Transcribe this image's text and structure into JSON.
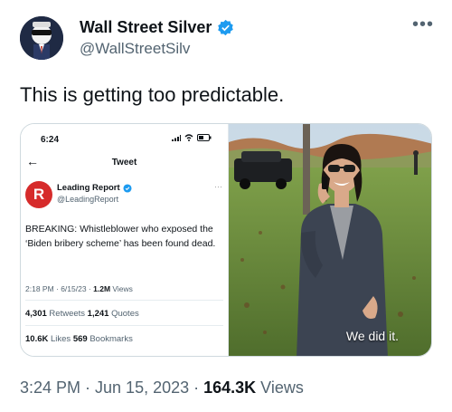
{
  "author": {
    "display_name": "Wall Street Silver",
    "handle": "@WallStreetSilv"
  },
  "more_icon": "more-dots-icon",
  "tweet_text": "This is getting too predictable.",
  "screenshot": {
    "status_time": "6:24",
    "screen_title": "Tweet",
    "inner_author": {
      "name": "Leading Report",
      "handle": "@LeadingReport",
      "avatar_letter": "R"
    },
    "body": "BREAKING: Whistleblower who exposed the ‘Biden bribery scheme’ has been found dead.",
    "meta_time": "2:18 PM · 6/15/23 · ",
    "meta_views_value": "1.2M",
    "meta_views_label": " Views",
    "retweets_value": "4,301",
    "retweets_label": " Retweets ",
    "quotes_value": "1,241",
    "quotes_label": " Quotes",
    "likes_value": "10.6K",
    "likes_label": " Likes ",
    "bookmarks_value": "569",
    "bookmarks_label": " Bookmarks"
  },
  "photo_caption": "We did it.",
  "footer": {
    "timestamp": "3:24 PM · Jun 15, 2023 · ",
    "views_value": "164.3K",
    "views_label": " Views"
  },
  "colors": {
    "verified": "#1d9bf0",
    "text_primary": "#0f1419",
    "text_secondary": "#536471",
    "leading_report_red": "#d62b2b"
  }
}
